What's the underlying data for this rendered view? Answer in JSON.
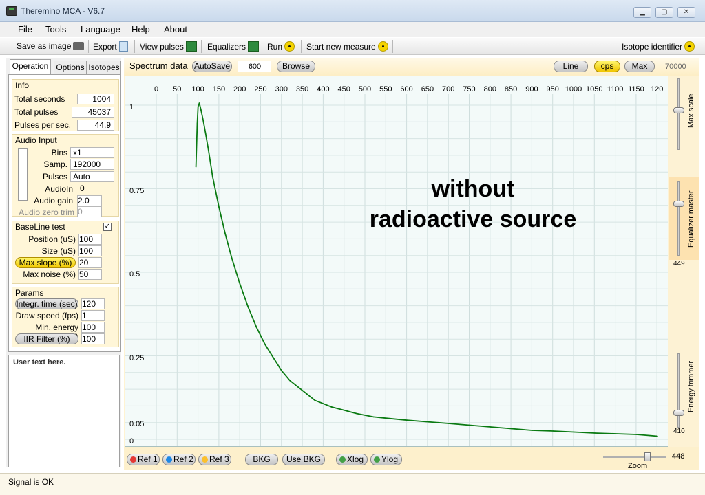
{
  "window": {
    "title": "Theremino MCA - V6.7"
  },
  "menu": [
    "File",
    "Tools",
    "Language",
    "Help",
    "About"
  ],
  "toolbar": {
    "save_image": "Save as image",
    "export": "Export",
    "view_pulses": "View pulses",
    "equalizers": "Equalizers",
    "run": "Run",
    "start_new": "Start new measure",
    "isotope": "Isotope identifier"
  },
  "tabs": [
    "Operation",
    "Options",
    "Isotopes"
  ],
  "info": {
    "title": "Info",
    "total_seconds_label": "Total seconds",
    "total_seconds": "1004",
    "total_pulses_label": "Total pulses",
    "total_pulses": "45037",
    "pps_label": "Pulses per sec.",
    "pps": "44.9"
  },
  "audio": {
    "title": "Audio Input",
    "bins_label": "Bins",
    "bins": "x1",
    "samp_label": "Samp.",
    "samp": "192000",
    "pulses_label": "Pulses",
    "pulses": "Auto",
    "audioin_label": "AudioIn",
    "audioin": "0",
    "gain_label": "Audio gain",
    "gain": "2.0",
    "zero_label": "Audio zero trim",
    "zero": "0"
  },
  "baseline": {
    "title": "BaseLine test",
    "checkbox_checked": true,
    "pos_label": "Position (uS)",
    "pos": "100",
    "size_label": "Size (uS)",
    "size": "100",
    "slope_label": "Max slope (%)",
    "slope": "20",
    "noise_label": "Max noise (%)",
    "noise": "50"
  },
  "params": {
    "title": "Params",
    "integr_label": "Integr. time (sec)",
    "integr": "120",
    "draw_label": "Draw speed (fps)",
    "draw": "1",
    "minen_label": "Min. energy (KeV)",
    "minen": "100",
    "iir_label": "IIR Filter (%)",
    "iir": "100"
  },
  "user_text": "User text here.",
  "status": "Signal is OK",
  "spectrum": {
    "title": "Spectrum data",
    "autosave": "AutoSave",
    "value": "600",
    "browse": "Browse",
    "line": "Line",
    "cps": "cps",
    "max": "Max",
    "max_value": "70000"
  },
  "right": {
    "max_scale": "Max scale",
    "eq_master": "Equalizer master",
    "eq_value": "449",
    "energy_trimmer": "Energy trimmer",
    "trim_value": "410",
    "zoom_value": "448",
    "zoom": "Zoom"
  },
  "bottom": {
    "ref1": "Ref 1",
    "ref2": "Ref 2",
    "ref3": "Ref 3",
    "bkg": "BKG",
    "use_bkg": "Use BKG",
    "xlog": "Xlog",
    "ylog": "Ylog"
  },
  "overlay": {
    "line1": "without",
    "line2": "radioactive source"
  },
  "chart_data": {
    "type": "line",
    "x_ticks": [
      "0",
      "50",
      "100",
      "150",
      "200",
      "250",
      "300",
      "350",
      "400",
      "450",
      "500",
      "550",
      "600",
      "650",
      "700",
      "750",
      "800",
      "850",
      "900",
      "950",
      "1000",
      "1050",
      "1100",
      "1150",
      "120"
    ],
    "y_ticks": [
      "1",
      "0.75",
      "0.5",
      "0.25",
      "0.05",
      "0"
    ],
    "xlim": [
      0,
      1200
    ],
    "ylim": [
      0,
      1.02
    ],
    "line_color": "#0a7a12",
    "x": [
      95,
      98,
      100,
      103,
      107,
      112,
      118,
      125,
      135,
      150,
      165,
      180,
      200,
      220,
      240,
      260,
      280,
      300,
      320,
      340,
      360,
      380,
      400,
      420,
      450,
      480,
      520,
      560,
      600,
      650,
      700,
      750,
      800,
      850,
      900,
      950,
      1000,
      1050,
      1100,
      1150,
      1180,
      1200
    ],
    "y": [
      0.82,
      0.95,
      1.0,
      1.01,
      0.99,
      0.96,
      0.92,
      0.87,
      0.79,
      0.7,
      0.62,
      0.55,
      0.47,
      0.4,
      0.34,
      0.29,
      0.25,
      0.21,
      0.18,
      0.16,
      0.14,
      0.12,
      0.11,
      0.1,
      0.09,
      0.08,
      0.07,
      0.065,
      0.06,
      0.055,
      0.05,
      0.045,
      0.04,
      0.035,
      0.03,
      0.028,
      0.025,
      0.022,
      0.02,
      0.018,
      0.015,
      0.013
    ]
  }
}
